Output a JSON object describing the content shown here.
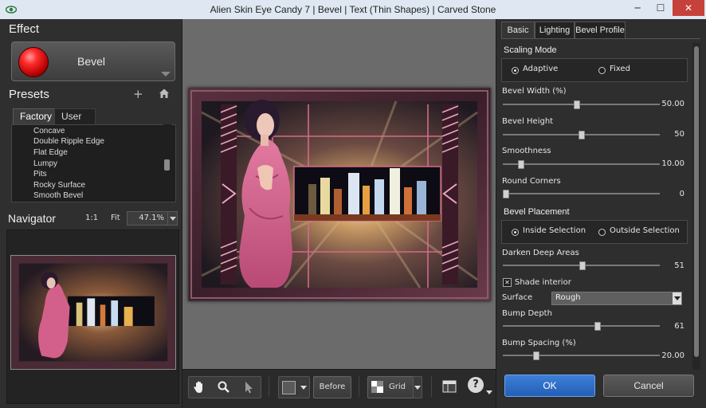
{
  "window": {
    "title": "Alien Skin Eye Candy 7 | Bevel | Text (Thin Shapes) | Carved Stone",
    "minimize": "─",
    "maximize": "☐",
    "close": "✕"
  },
  "effect": {
    "heading": "Effect",
    "name": "Bevel"
  },
  "presets": {
    "heading": "Presets",
    "tabs": [
      "Factory",
      "User"
    ],
    "items": [
      "Concave",
      "Double Ripple Edge",
      "Flat Edge",
      "Lumpy",
      "Pits",
      "Rocky Surface",
      "Smooth Bevel"
    ]
  },
  "navigator": {
    "heading": "Navigator",
    "one_to_one": "1:1",
    "fit": "Fit",
    "zoom": "47.1%"
  },
  "toolbar": {
    "before": "Before",
    "grid": "Grid",
    "help": "?"
  },
  "settings": {
    "tabs": [
      "Basic",
      "Lighting",
      "Bevel Profile"
    ],
    "scaling_mode": {
      "title": "Scaling Mode",
      "options": [
        "Adaptive",
        "Fixed"
      ],
      "selected": "Adaptive"
    },
    "bevel_width": {
      "label": "Bevel Width (%)",
      "value": "50.00",
      "fraction": 0.47
    },
    "bevel_height": {
      "label": "Bevel Height",
      "value": "50",
      "fraction": 0.5
    },
    "smoothness": {
      "label": "Smoothness",
      "value": "10.00",
      "fraction": 0.1
    },
    "round_corners": {
      "label": "Round Corners",
      "value": "0",
      "fraction": 0.0
    },
    "bevel_placement": {
      "title": "Bevel Placement",
      "options": [
        "Inside Selection",
        "Outside Selection"
      ],
      "selected": "Inside Selection"
    },
    "darken_deep_areas": {
      "label": "Darken Deep Areas",
      "value": "51",
      "fraction": 0.51
    },
    "shade_interior": {
      "label": "Shade interior",
      "checked": true
    },
    "surface": {
      "label": "Surface",
      "value": "Rough"
    },
    "bump_depth": {
      "label": "Bump Depth",
      "value": "61",
      "fraction": 0.61
    },
    "bump_spacing": {
      "label": "Bump Spacing (%)",
      "value": "20.00",
      "fraction": 0.2
    }
  },
  "actions": {
    "ok": "OK",
    "cancel": "Cancel"
  },
  "colors": {
    "ok_blue": "#2f6fcc",
    "effect_red": "#e01010",
    "panel_dark": "#2e2e2e",
    "canvas_gray": "#6b6b6b"
  }
}
